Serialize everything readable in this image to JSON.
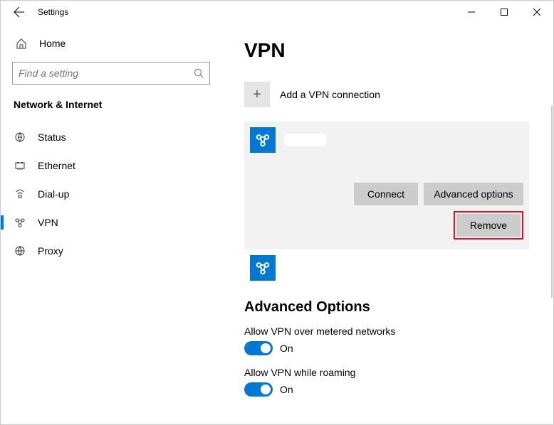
{
  "window": {
    "title": "Settings"
  },
  "sidebar": {
    "home": "Home",
    "search_placeholder": "Find a setting",
    "category": "Network & Internet",
    "items": [
      {
        "label": "Status"
      },
      {
        "label": "Ethernet"
      },
      {
        "label": "Dial-up"
      },
      {
        "label": "VPN"
      },
      {
        "label": "Proxy"
      }
    ]
  },
  "main": {
    "heading": "VPN",
    "add_label": "Add a VPN connection",
    "connect": "Connect",
    "advanced": "Advanced options",
    "remove": "Remove",
    "adv_heading": "Advanced Options",
    "opt1_label": "Allow VPN over metered networks",
    "opt1_state": "On",
    "opt2_label": "Allow VPN while roaming",
    "opt2_state": "On"
  }
}
